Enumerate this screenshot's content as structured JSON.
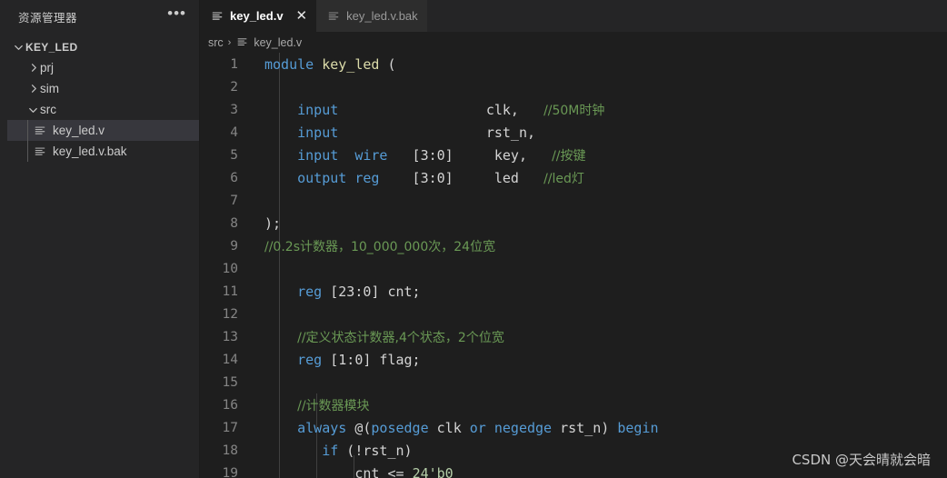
{
  "sidebar": {
    "title": "资源管理器",
    "more_label": "•••",
    "tree": [
      {
        "level": 0,
        "twisty": "chevron-down",
        "label": "KEY_LED",
        "kind": "root",
        "selected": false,
        "name": "tree-root-key-led"
      },
      {
        "level": 1,
        "twisty": "chevron-right",
        "label": "prj",
        "kind": "folder",
        "selected": false,
        "name": "tree-folder-prj"
      },
      {
        "level": 1,
        "twisty": "chevron-right",
        "label": "sim",
        "kind": "folder",
        "selected": false,
        "name": "tree-folder-sim"
      },
      {
        "level": 1,
        "twisty": "chevron-down",
        "label": "src",
        "kind": "folder",
        "selected": false,
        "name": "tree-folder-src"
      },
      {
        "level": 2,
        "twisty": "",
        "label": "key_led.v",
        "kind": "file",
        "selected": true,
        "name": "tree-file-key-led-v"
      },
      {
        "level": 2,
        "twisty": "",
        "label": "key_led.v.bak",
        "kind": "file",
        "selected": false,
        "name": "tree-file-key-led-v-bak"
      }
    ]
  },
  "tabs": [
    {
      "label": "key_led.v",
      "active": true,
      "close_label": "✕",
      "name": "tab-key-led-v"
    },
    {
      "label": "key_led.v.bak",
      "active": false,
      "close_label": "",
      "name": "tab-key-led-v-bak"
    }
  ],
  "breadcrumb": {
    "folder": "src",
    "separator": "›",
    "file": "key_led.v"
  },
  "code": {
    "lines": [
      {
        "n": "1",
        "tokens": [
          {
            "t": "kw",
            "s": "module"
          },
          {
            "t": "pl",
            "s": " "
          },
          {
            "t": "fn",
            "s": "key_led"
          },
          {
            "t": "pl",
            "s": " ("
          }
        ]
      },
      {
        "n": "2",
        "tokens": []
      },
      {
        "n": "3",
        "tokens": [
          {
            "t": "pl",
            "s": "    "
          },
          {
            "t": "kw",
            "s": "input"
          },
          {
            "t": "pl",
            "s": "                  clk,   "
          },
          {
            "t": "cm",
            "s": "//50M时钟"
          }
        ]
      },
      {
        "n": "4",
        "tokens": [
          {
            "t": "pl",
            "s": "    "
          },
          {
            "t": "kw",
            "s": "input"
          },
          {
            "t": "pl",
            "s": "                  rst_n,"
          }
        ]
      },
      {
        "n": "5",
        "tokens": [
          {
            "t": "pl",
            "s": "    "
          },
          {
            "t": "kw",
            "s": "input"
          },
          {
            "t": "pl",
            "s": "  "
          },
          {
            "t": "kw",
            "s": "wire"
          },
          {
            "t": "pl",
            "s": "   [3:0]     key,   "
          },
          {
            "t": "cm",
            "s": "//按键"
          }
        ]
      },
      {
        "n": "6",
        "tokens": [
          {
            "t": "pl",
            "s": "    "
          },
          {
            "t": "kw",
            "s": "output"
          },
          {
            "t": "pl",
            "s": " "
          },
          {
            "t": "kw",
            "s": "reg"
          },
          {
            "t": "pl",
            "s": "    [3:0]     led   "
          },
          {
            "t": "cm",
            "s": "//led灯"
          }
        ]
      },
      {
        "n": "7",
        "tokens": []
      },
      {
        "n": "8",
        "tokens": [
          {
            "t": "pl",
            "s": ");"
          }
        ]
      },
      {
        "n": "9",
        "tokens": [
          {
            "t": "cm",
            "s": "//0.2s计数器，10_000_000次，24位宽"
          }
        ]
      },
      {
        "n": "10",
        "tokens": []
      },
      {
        "n": "11",
        "tokens": [
          {
            "t": "pl",
            "s": "    "
          },
          {
            "t": "kw",
            "s": "reg"
          },
          {
            "t": "pl",
            "s": " [23:0] cnt;"
          }
        ]
      },
      {
        "n": "12",
        "tokens": []
      },
      {
        "n": "13",
        "tokens": [
          {
            "t": "pl",
            "s": "    "
          },
          {
            "t": "cm",
            "s": "//定义状态计数器,4个状态，2个位宽"
          }
        ]
      },
      {
        "n": "14",
        "tokens": [
          {
            "t": "pl",
            "s": "    "
          },
          {
            "t": "kw",
            "s": "reg"
          },
          {
            "t": "pl",
            "s": " [1:0] flag;"
          }
        ]
      },
      {
        "n": "15",
        "tokens": []
      },
      {
        "n": "16",
        "tokens": [
          {
            "t": "pl",
            "s": "    "
          },
          {
            "t": "cm",
            "s": "//计数器模块"
          }
        ]
      },
      {
        "n": "17",
        "tokens": [
          {
            "t": "pl",
            "s": "    "
          },
          {
            "t": "kw",
            "s": "always"
          },
          {
            "t": "pl",
            "s": " @("
          },
          {
            "t": "kw",
            "s": "posedge"
          },
          {
            "t": "pl",
            "s": " clk "
          },
          {
            "t": "kw",
            "s": "or"
          },
          {
            "t": "pl",
            "s": " "
          },
          {
            "t": "kw",
            "s": "negedge"
          },
          {
            "t": "pl",
            "s": " rst_n) "
          },
          {
            "t": "kw",
            "s": "begin"
          }
        ]
      },
      {
        "n": "18",
        "tokens": [
          {
            "t": "pl",
            "s": "       "
          },
          {
            "t": "kw",
            "s": "if"
          },
          {
            "t": "pl",
            "s": " (!rst_n)"
          }
        ]
      },
      {
        "n": "19",
        "tokens": [
          {
            "t": "pl",
            "s": "           cnt <= "
          },
          {
            "t": "num",
            "s": "24'b0"
          }
        ]
      }
    ]
  },
  "watermark": "CSDN @天会晴就会暗",
  "colors": {
    "editor_bg": "#1e1e1e",
    "sidebar_bg": "#252526",
    "tab_inactive_bg": "#2d2d2d",
    "selection_bg": "#37373d",
    "keyword": "#569cd6",
    "function": "#dcdcaa",
    "comment": "#6a9955",
    "number": "#b5cea8",
    "text": "#d4d4d4",
    "line_number": "#858585"
  }
}
